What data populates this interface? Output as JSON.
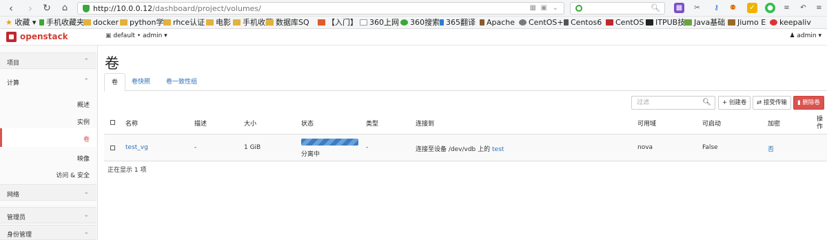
{
  "browser": {
    "url_host": "http://10.0.0.12",
    "url_path": "/dashboard/project/volumes/",
    "search_placeholder": "",
    "bookmarks": [
      "收藏",
      "手机收藏夹",
      "docker",
      "python学",
      "rhce认证",
      "电影",
      "手机收藏",
      "数据库SQ",
      "【入门】",
      "360上网",
      "360搜索",
      "365翻译",
      "Apache",
      "CentOS+",
      "Centos6",
      "CentOS",
      "ITPUB技",
      "Java基础",
      "Jiumo E",
      "keepaliv"
    ]
  },
  "header": {
    "brand": "openstack",
    "project_selector": "default • admin ▾",
    "user_menu": "admin ▾"
  },
  "sidebar": {
    "project": "项目",
    "compute": "计算",
    "items": [
      "概述",
      "实例",
      "卷",
      "映像",
      "访问 & 安全"
    ],
    "network": "网络",
    "admin": "管理员",
    "identity": "身份管理"
  },
  "page": {
    "title": "卷",
    "tabs": [
      "卷",
      "卷快照",
      "卷一致性组"
    ]
  },
  "toolbar": {
    "filter_placeholder": "过滤",
    "create": "+ 创建卷",
    "accept": "⇄ 接受传输",
    "delete": "删除卷"
  },
  "table": {
    "headers": [
      "名称",
      "描述",
      "大小",
      "状态",
      "类型",
      "连接到",
      "可用域",
      "可启动",
      "加密",
      "操作"
    ],
    "rows": [
      {
        "name": "test_vg",
        "description": "-",
        "size": "1 GiB",
        "status_bar": "",
        "status_progress": 1.0,
        "status": "分离中",
        "type": "-",
        "attached_prefix": "连接至设备 /dev/vdb 上的",
        "attached_instance": "test",
        "zone": "nova",
        "bootable": "False",
        "encrypted": "否"
      }
    ],
    "count": "正在显示 1 项"
  },
  "colors": {
    "accent": "#d9534f",
    "link": "#2c70b8",
    "brand": "#c1282d",
    "progress": "#3c7cc3"
  }
}
